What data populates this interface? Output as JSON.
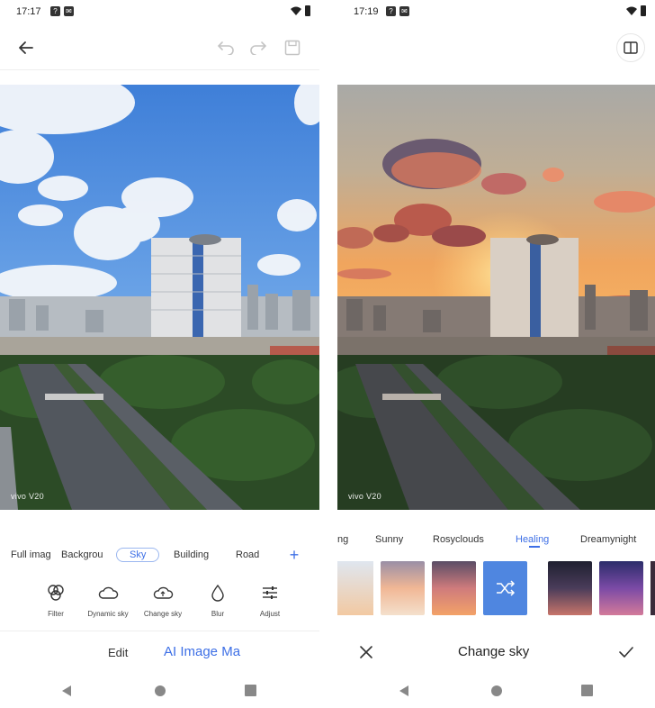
{
  "left": {
    "status": {
      "time": "17:17"
    },
    "photo": {
      "watermark": "vivo V20"
    },
    "categories": [
      "Full imag",
      "Backgrou",
      "Sky",
      "Building",
      "Road"
    ],
    "tools": [
      {
        "label": "Filter",
        "icon": "filter-icon"
      },
      {
        "label": "Dynamic sky",
        "icon": "cloud-icon"
      },
      {
        "label": "Change sky",
        "icon": "cloud-upload-icon"
      },
      {
        "label": "Blur",
        "icon": "drop-icon"
      },
      {
        "label": "Adjust",
        "icon": "sliders-icon"
      }
    ],
    "bottom_tabs": {
      "edit": "Edit",
      "ai": "AI Image Ma"
    }
  },
  "right": {
    "status": {
      "time": "17:19"
    },
    "photo": {
      "watermark": "vivo V20"
    },
    "sky_tabs": [
      "ng",
      "Sunny",
      "Rosyclouds",
      "Healing",
      "Dreamynight"
    ],
    "action_title": "Change sky"
  },
  "colors": {
    "accent": "#3d6fe6",
    "text": "#222222"
  }
}
